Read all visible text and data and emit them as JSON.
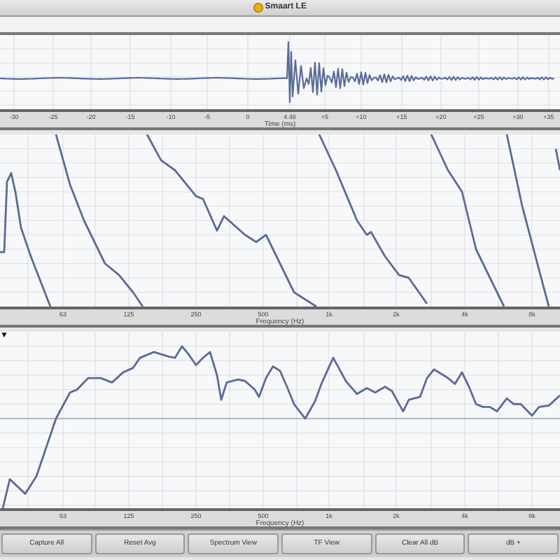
{
  "window": {
    "title": "Smaart LE"
  },
  "impulse_panel": {
    "ticks": [
      "-30",
      "-25",
      "-20",
      "-15",
      "-10",
      "-5",
      "0",
      "4.48",
      "+5",
      "+10",
      "+15",
      "+20",
      "+25",
      "+30",
      "+35"
    ],
    "xlabel": "Time (ms)"
  },
  "decay_panel": {
    "ticks": [
      "63",
      "125",
      "250",
      "500",
      "1k",
      "2k",
      "4k",
      "8k"
    ],
    "xlabel": "Frequency (Hz)"
  },
  "response_panel": {
    "menu": "▼",
    "ticks": [
      "63",
      "125",
      "250",
      "500",
      "1k",
      "2k",
      "4k",
      "8k"
    ],
    "xlabel": "Frequency (Hz)"
  },
  "buttons": [
    "Capture All",
    "Reset Avg",
    "Spectrum View",
    "TF View",
    "Clear All dB",
    "dB +"
  ]
}
